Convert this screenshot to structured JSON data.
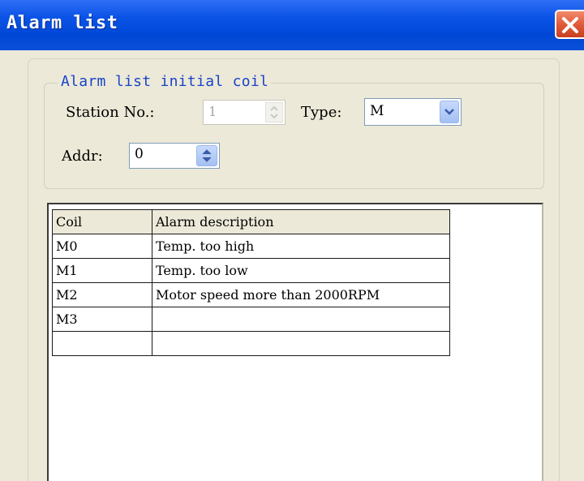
{
  "window": {
    "title": "Alarm list"
  },
  "group": {
    "legend": "Alarm list initial coil",
    "station_label": "Station No.:",
    "station_value": "1",
    "type_label": "Type:",
    "type_value": "M",
    "addr_label": "Addr:",
    "addr_value": "0"
  },
  "table": {
    "columns": [
      "Coil",
      "Alarm description"
    ],
    "rows": [
      {
        "coil": "M0",
        "desc": "Temp. too high"
      },
      {
        "coil": "M1",
        "desc": "Temp. too low"
      },
      {
        "coil": "M2",
        "desc": "Motor speed more than 2000RPM"
      },
      {
        "coil": "M3",
        "desc": ""
      },
      {
        "coil": "",
        "desc": ""
      }
    ]
  },
  "icons": {
    "close": "close-icon",
    "spin": "spin-arrows-icon",
    "dropdown": "chevron-down-icon"
  },
  "colors": {
    "titlebar": "#0a53e6",
    "dialog_bg": "#ece9d8",
    "group_legend": "#1a44c8",
    "close_button": "#e05a3a"
  }
}
